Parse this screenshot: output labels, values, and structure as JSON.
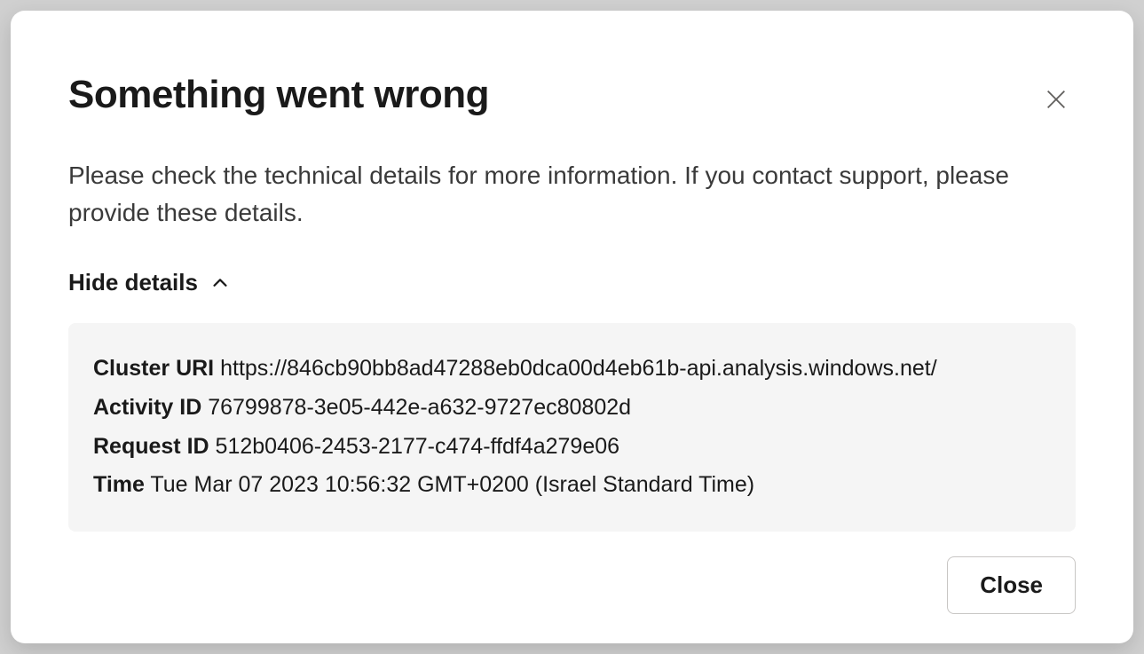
{
  "dialog": {
    "title": "Something went wrong",
    "description": "Please check the technical details for more information. If you contact support, please provide these details.",
    "toggle_label": "Hide details",
    "details": {
      "cluster_uri_label": "Cluster URI",
      "cluster_uri_value": "https://846cb90bb8ad47288eb0dca00d4eb61b-api.analysis.windows.net/",
      "activity_id_label": "Activity ID",
      "activity_id_value": "76799878-3e05-442e-a632-9727ec80802d",
      "request_id_label": "Request ID",
      "request_id_value": "512b0406-2453-2177-c474-ffdf4a279e06",
      "time_label": "Time",
      "time_value": "Tue Mar 07 2023 10:56:32 GMT+0200 (Israel Standard Time)"
    },
    "close_label": "Close"
  }
}
